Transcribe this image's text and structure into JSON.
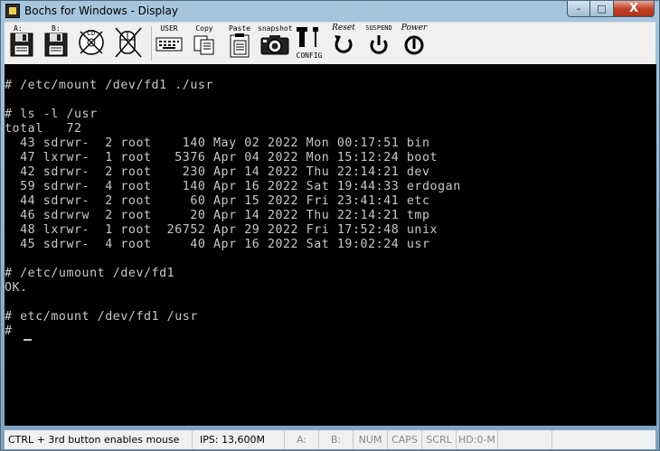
{
  "window": {
    "title": "Bochs for Windows - Display",
    "controls": {
      "minimize": "–",
      "maximize": "□",
      "close": "X"
    }
  },
  "toolbar": {
    "floppy_a": {
      "label": "A:",
      "icon": "floppy-disk-icon"
    },
    "floppy_b": {
      "label": "B:",
      "icon": "floppy-disk-icon"
    },
    "cdrom": {
      "label": "CD",
      "icon": "cdrom-icon"
    },
    "mouse": {
      "icon": "mouse-icon"
    },
    "user": {
      "label": "USER",
      "icon": "keyboard-icon"
    },
    "copy": {
      "label": "Copy",
      "icon": "copy-icon"
    },
    "paste": {
      "label": "Paste",
      "icon": "paste-icon"
    },
    "snapshot": {
      "label": "snapshot",
      "icon": "camera-icon"
    },
    "config": {
      "label": "CONFIG",
      "icon": "config-tools-icon"
    },
    "reset": {
      "label": "Reset",
      "icon": "reset-icon"
    },
    "suspend": {
      "label": "SUSPEND",
      "icon": "suspend-icon"
    },
    "power": {
      "label": "Power",
      "icon": "power-icon"
    }
  },
  "terminal": {
    "lines": [
      "",
      "# /etc/mount /dev/fd1 ./usr",
      "",
      "# ls -l /usr",
      "total   72",
      "  43 sdrwr-  2 root    140 May 02 2022 Mon 00:17:51 bin",
      "  47 lxrwr-  1 root   5376 Apr 04 2022 Mon 15:12:24 boot",
      "  42 sdrwr-  2 root    230 Apr 14 2022 Thu 22:14:21 dev",
      "  59 sdrwr-  4 root    140 Apr 16 2022 Sat 19:44:33 erdogan",
      "  44 sdrwr-  2 root     60 Apr 15 2022 Fri 23:41:41 etc",
      "  46 sdrwrw  2 root     20 Apr 14 2022 Thu 22:14:21 tmp",
      "  48 lxrwr-  1 root  26752 Apr 29 2022 Fri 17:52:48 unix",
      "  45 sdrwr-  4 root     40 Apr 16 2022 Sat 19:02:24 usr",
      "",
      "# /etc/umount /dev/fd1",
      "OK.",
      "",
      "# etc/mount /dev/fd1 /usr",
      "#"
    ],
    "colors": {
      "background": "#000000",
      "text": "#c8c8c8"
    }
  },
  "statusbar": {
    "hint": "CTRL + 3rd button enables mouse",
    "ips": "IPS: 13,600M",
    "a": "A:",
    "b": "B:",
    "num": "NUM",
    "caps": "CAPS",
    "scrl": "SCRL",
    "hd": "HD:0-M"
  }
}
